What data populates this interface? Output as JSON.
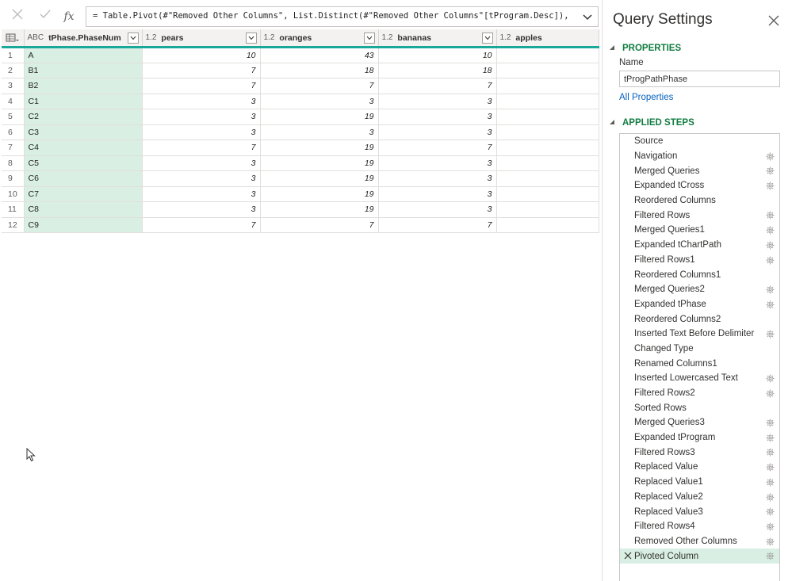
{
  "formula_bar": {
    "cancel_icon": "close-icon",
    "confirm_icon": "checkmark-icon",
    "fx_label": "fx",
    "formula": "= Table.Pivot(#\"Removed Other Columns\", List.Distinct(#\"Removed Other Columns\"[tProgram.Desc]),"
  },
  "grid": {
    "columns": [
      {
        "type": "ABC",
        "name": "tPhase.PhaseNum"
      },
      {
        "type": "1.2",
        "name": "pears"
      },
      {
        "type": "1.2",
        "name": "oranges"
      },
      {
        "type": "1.2",
        "name": "bananas"
      },
      {
        "type": "1.2",
        "name": "apples"
      }
    ],
    "rows": [
      {
        "n": "1",
        "phase": "A",
        "pears": "10",
        "oranges": "43",
        "bananas": "10",
        "apples": ""
      },
      {
        "n": "2",
        "phase": "B1",
        "pears": "7",
        "oranges": "18",
        "bananas": "18",
        "apples": ""
      },
      {
        "n": "3",
        "phase": "B2",
        "pears": "7",
        "oranges": "7",
        "bananas": "7",
        "apples": ""
      },
      {
        "n": "4",
        "phase": "C1",
        "pears": "3",
        "oranges": "3",
        "bananas": "3",
        "apples": ""
      },
      {
        "n": "5",
        "phase": "C2",
        "pears": "3",
        "oranges": "19",
        "bananas": "3",
        "apples": ""
      },
      {
        "n": "6",
        "phase": "C3",
        "pears": "3",
        "oranges": "3",
        "bananas": "3",
        "apples": ""
      },
      {
        "n": "7",
        "phase": "C4",
        "pears": "7",
        "oranges": "19",
        "bananas": "7",
        "apples": ""
      },
      {
        "n": "8",
        "phase": "C5",
        "pears": "3",
        "oranges": "19",
        "bananas": "3",
        "apples": ""
      },
      {
        "n": "9",
        "phase": "C6",
        "pears": "3",
        "oranges": "19",
        "bananas": "3",
        "apples": ""
      },
      {
        "n": "10",
        "phase": "C7",
        "pears": "3",
        "oranges": "19",
        "bananas": "3",
        "apples": ""
      },
      {
        "n": "11",
        "phase": "C8",
        "pears": "3",
        "oranges": "19",
        "bananas": "3",
        "apples": ""
      },
      {
        "n": "12",
        "phase": "C9",
        "pears": "7",
        "oranges": "7",
        "bananas": "7",
        "apples": ""
      }
    ]
  },
  "query_settings": {
    "title": "Query Settings",
    "properties_header": "PROPERTIES",
    "name_label": "Name",
    "name_value": "tProgPathPhase",
    "all_properties_link": "All Properties",
    "applied_steps_header": "APPLIED STEPS",
    "steps": [
      {
        "label": "Source",
        "gear": false,
        "selected": false
      },
      {
        "label": "Navigation",
        "gear": true,
        "selected": false
      },
      {
        "label": "Merged Queries",
        "gear": true,
        "selected": false
      },
      {
        "label": "Expanded tCross",
        "gear": true,
        "selected": false
      },
      {
        "label": "Reordered Columns",
        "gear": false,
        "selected": false
      },
      {
        "label": "Filtered Rows",
        "gear": true,
        "selected": false
      },
      {
        "label": "Merged Queries1",
        "gear": true,
        "selected": false
      },
      {
        "label": "Expanded tChartPath",
        "gear": true,
        "selected": false
      },
      {
        "label": "Filtered Rows1",
        "gear": true,
        "selected": false
      },
      {
        "label": "Reordered Columns1",
        "gear": false,
        "selected": false
      },
      {
        "label": "Merged Queries2",
        "gear": true,
        "selected": false
      },
      {
        "label": "Expanded tPhase",
        "gear": true,
        "selected": false
      },
      {
        "label": "Reordered Columns2",
        "gear": false,
        "selected": false
      },
      {
        "label": "Inserted Text Before Delimiter",
        "gear": true,
        "selected": false
      },
      {
        "label": "Changed Type",
        "gear": false,
        "selected": false
      },
      {
        "label": "Renamed Columns1",
        "gear": false,
        "selected": false
      },
      {
        "label": "Inserted Lowercased Text",
        "gear": true,
        "selected": false
      },
      {
        "label": "Filtered Rows2",
        "gear": true,
        "selected": false
      },
      {
        "label": "Sorted Rows",
        "gear": false,
        "selected": false
      },
      {
        "label": "Merged Queries3",
        "gear": true,
        "selected": false
      },
      {
        "label": "Expanded tProgram",
        "gear": true,
        "selected": false
      },
      {
        "label": "Filtered Rows3",
        "gear": true,
        "selected": false
      },
      {
        "label": "Replaced Value",
        "gear": true,
        "selected": false
      },
      {
        "label": "Replaced Value1",
        "gear": true,
        "selected": false
      },
      {
        "label": "Replaced Value2",
        "gear": true,
        "selected": false
      },
      {
        "label": "Replaced Value3",
        "gear": true,
        "selected": false
      },
      {
        "label": "Filtered Rows4",
        "gear": true,
        "selected": false
      },
      {
        "label": "Removed Other Columns",
        "gear": true,
        "selected": false
      },
      {
        "label": "Pivoted Column",
        "gear": true,
        "selected": true
      }
    ]
  },
  "colors": {
    "accent_teal": "#19a89a",
    "selected_column_fill": "#d9efe3",
    "section_green": "#107c41",
    "link_blue": "#0563c1"
  }
}
